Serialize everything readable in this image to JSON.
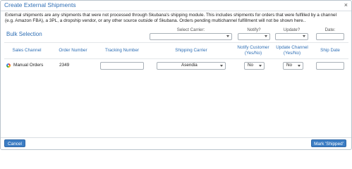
{
  "modal": {
    "title": "Create External Shipments",
    "close_glyph": "×",
    "description": "External shipments are any shipments that were not processed through Skubana's shipping module. This includes shipments for orders that were fulfilled by a channel (e.g. Amazon FBA), a 3PL, a dropship vendor, or any other source outside of Skubana. Orders pending multichannel fulfillment will not be shown here.."
  },
  "bulk": {
    "label": "Bulk Selection",
    "select_carrier_label": "Select Carrier:",
    "select_carrier_value": "",
    "notify_label": "Notify?",
    "notify_value": "",
    "update_label": "Update?",
    "update_value": "",
    "date_label": "Date:",
    "date_value": ""
  },
  "table": {
    "columns": [
      "Sales Channel",
      "Order Number",
      "Tracking Number",
      "Shipping Carrier",
      "Notify Customer (Yes/No)",
      "Update Channel (Yes/No)",
      "Ship Date"
    ],
    "rows": [
      {
        "channel_icon": "manual-orders-icon",
        "sales_channel": "Manual Orders",
        "order_number": "2349",
        "tracking_number": "",
        "shipping_carrier": "Asendia",
        "notify_customer": "No",
        "update_channel": "No",
        "ship_date": ""
      }
    ]
  },
  "footer": {
    "cancel_label": "Cancel",
    "mark_shipped_label": "Mark 'Shipped'"
  },
  "colors": {
    "accent": "#2f6fb5",
    "button": "#3c7dc4"
  }
}
